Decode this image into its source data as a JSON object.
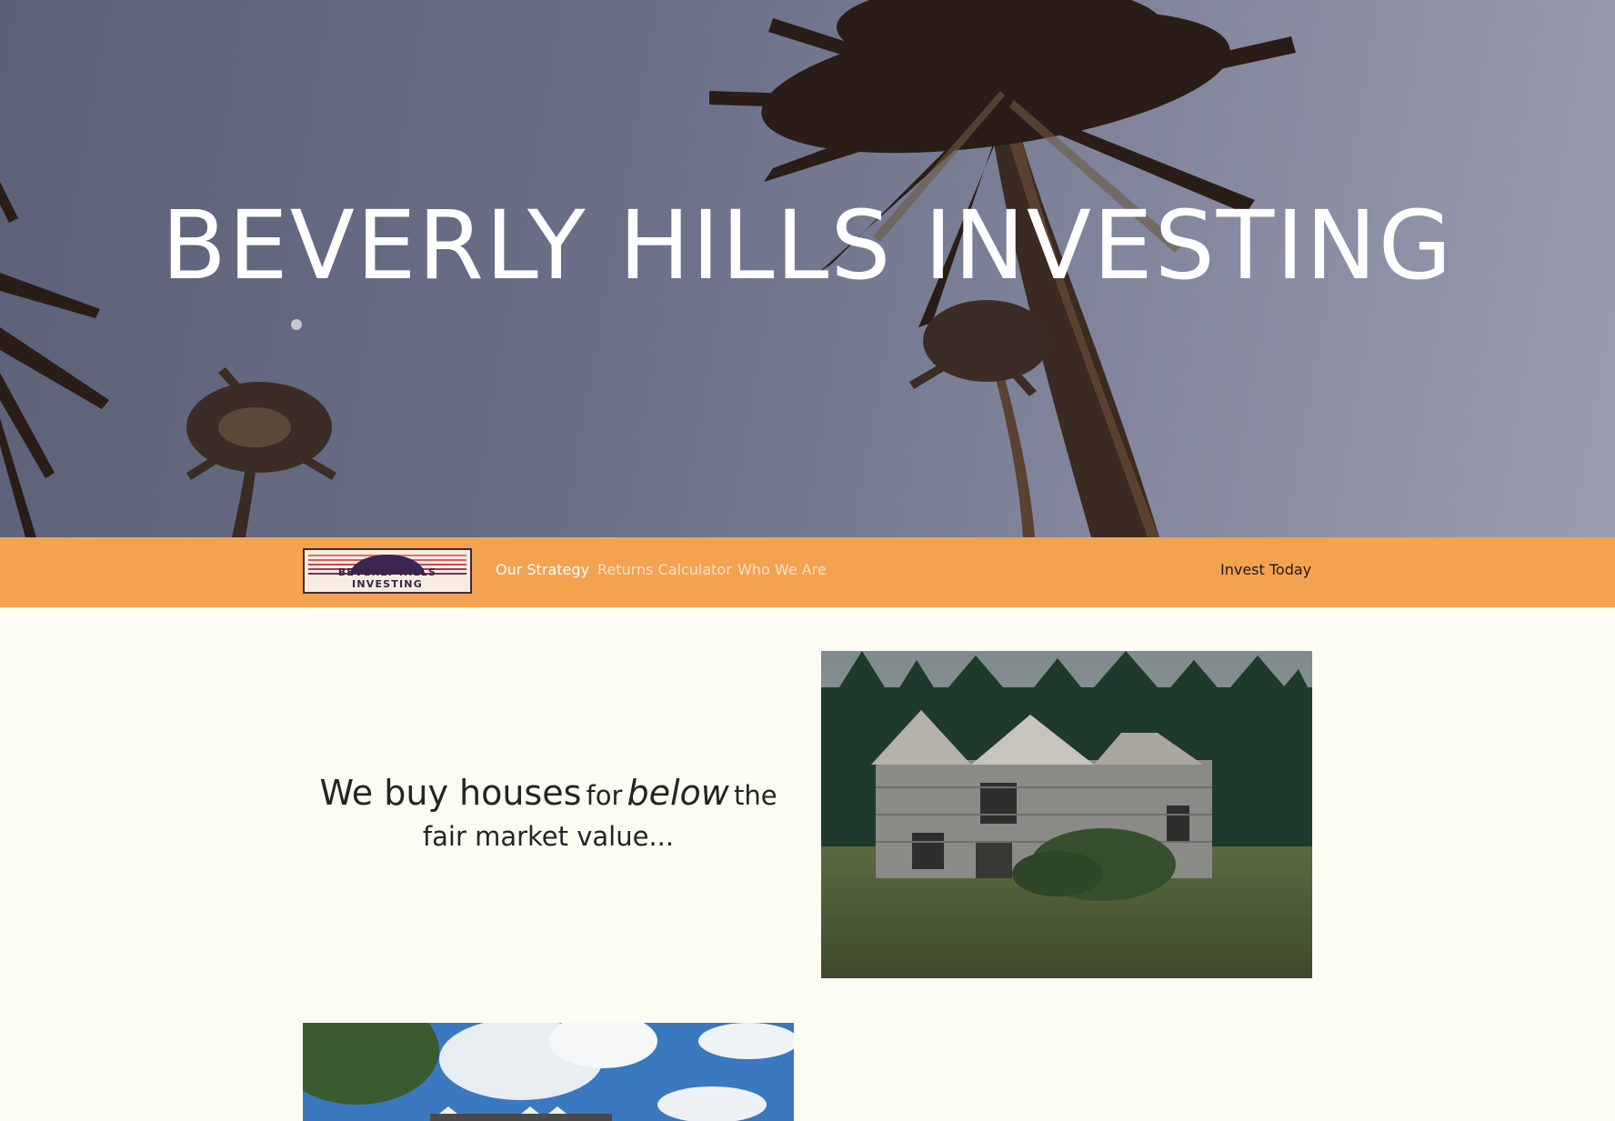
{
  "hero": {
    "title": "BEVERLY HILLS INVESTING"
  },
  "nav": {
    "logo_text": "BEVERLY HILLS INVESTING",
    "links": [
      {
        "label": "Our Strategy",
        "active": true
      },
      {
        "label": "Returns Calculator",
        "active": false
      },
      {
        "label": "Who We Are",
        "active": false
      }
    ],
    "cta": "Invest Today"
  },
  "main": {
    "headline": {
      "part1": "We buy houses",
      "part2": "for",
      "part3": "below",
      "part4": "the fair market value..."
    }
  },
  "colors": {
    "nav_bg": "#f3a250",
    "page_bg": "#fdfcf3",
    "hero_text": "#ffffff"
  }
}
